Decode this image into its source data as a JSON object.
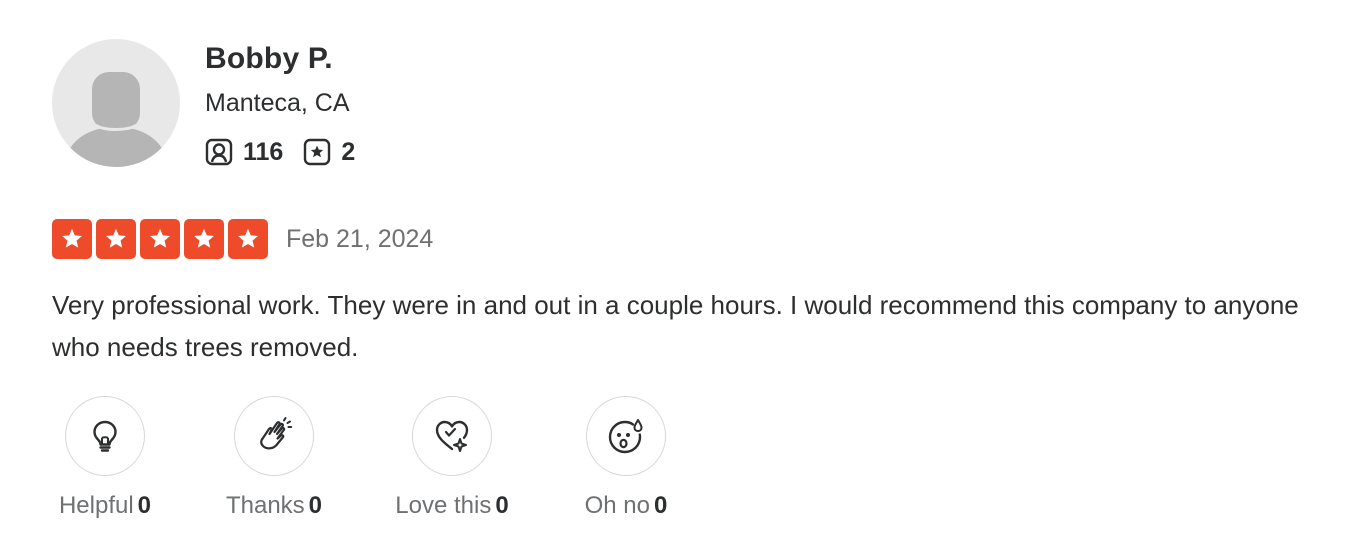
{
  "reviewer": {
    "name": "Bobby P.",
    "location": "Manteca, CA",
    "friends_count": "116",
    "reviews_count": "2",
    "avatar_icon": "default-avatar-icon"
  },
  "review": {
    "rating": 5,
    "rating_max": 5,
    "date": "Feb 21, 2024",
    "text": "Very professional work. They were in and out in a couple hours. I would recommend this company to anyone who needs trees removed."
  },
  "reactions": [
    {
      "label": "Helpful",
      "count": "0",
      "icon": "lightbulb-icon"
    },
    {
      "label": "Thanks",
      "count": "0",
      "icon": "clapping-hands-icon"
    },
    {
      "label": "Love this",
      "count": "0",
      "icon": "heart-sparkle-icon"
    },
    {
      "label": "Oh no",
      "count": "0",
      "icon": "surprised-face-icon"
    }
  ],
  "colors": {
    "star_fill": "#ee4b2b",
    "text_primary": "#2d2e2f",
    "text_secondary": "#6e7072",
    "avatar_bg": "#e8e8e8",
    "avatar_silhouette": "#b5b5b5"
  }
}
